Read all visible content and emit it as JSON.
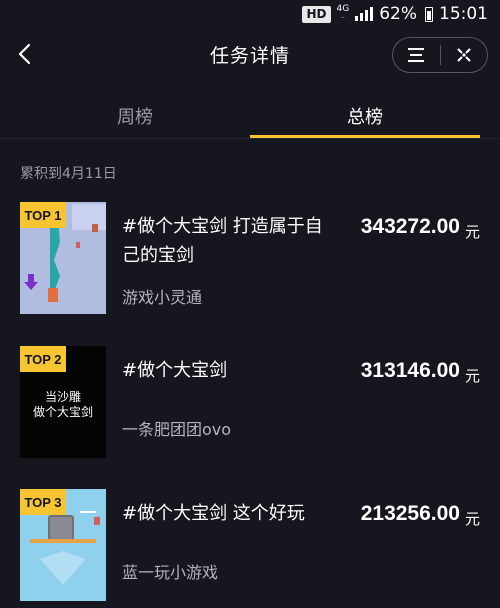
{
  "status_bar": {
    "hd": "HD",
    "network": "4G",
    "battery": "62%",
    "time": "15:01"
  },
  "header": {
    "title": "任务详情"
  },
  "tabs": [
    {
      "label": "周榜",
      "active": false
    },
    {
      "label": "总榜",
      "active": true
    }
  ],
  "cumulative_label": "累积到4月11日",
  "ranking": [
    {
      "rank": "TOP 1",
      "title": "#做个大宝剑 打造属于自己的宝剑",
      "author": "游戏小灵通",
      "amount": "343272.00",
      "unit": "元"
    },
    {
      "rank": "TOP 2",
      "title": "#做个大宝剑",
      "author": "一条肥团团ovo",
      "amount": "313146.00",
      "unit": "元",
      "thumb_text": [
        "当沙雕",
        "做个大宝剑"
      ]
    },
    {
      "rank": "TOP 3",
      "title": "#做个大宝剑 这个好玩",
      "author": "蓝一玩小游戏",
      "amount": "213256.00",
      "unit": "元"
    }
  ],
  "colors": {
    "background": "#16161f",
    "accent": "#f6c531",
    "muted_text": "#9a9aa3"
  }
}
